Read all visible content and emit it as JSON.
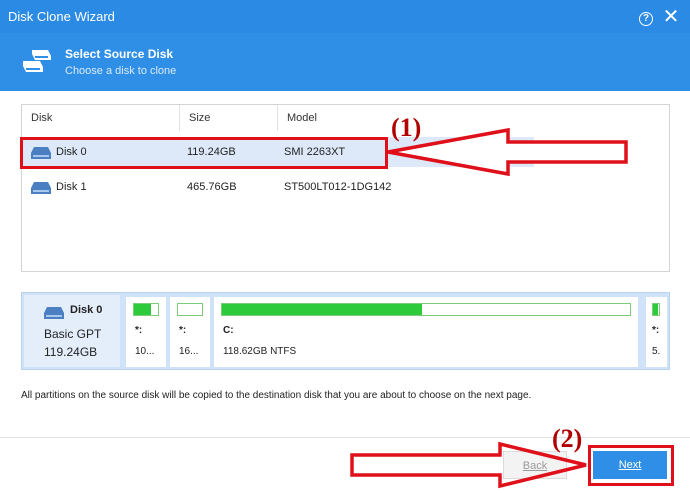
{
  "window": {
    "title": "Disk Clone Wizard",
    "help_glyph": "?",
    "close_glyph": "✕"
  },
  "header": {
    "title": "Select Source Disk",
    "subtitle": "Choose a disk to clone",
    "icon": "disk-stack-icon"
  },
  "table": {
    "columns": [
      "Disk",
      "Size",
      "Model"
    ],
    "rows": [
      {
        "disk": "Disk 0",
        "size": "119.24GB",
        "model": "SMI 2263XT",
        "selected": true
      },
      {
        "disk": "Disk 1",
        "size": "465.76GB",
        "model": "ST500LT012-1DG142",
        "selected": false
      }
    ]
  },
  "disk_map": {
    "name": "Disk 0",
    "type": "Basic GPT",
    "size": "119.24GB",
    "partitions": [
      {
        "name": "*:",
        "info": "10...",
        "usage": 0.7
      },
      {
        "name": "*:",
        "info": "16...",
        "usage": 0.0
      },
      {
        "name": "C:",
        "info": "118.62GB NTFS",
        "usage": 0.49
      },
      {
        "name": "*:",
        "info": "5.",
        "usage": 0.9
      }
    ]
  },
  "note": "All partitions on the source disk will be copied to the destination disk that you are about to choose on the next page.",
  "buttons": {
    "back": "Back",
    "next": "Next"
  },
  "annotations": {
    "step1": "(1)",
    "step2": "(2)"
  },
  "colors": {
    "accent": "#2f8fe6",
    "selected_row": "#dde9f8",
    "annotation_red": "#e0101a",
    "partition_green": "#2dca3b"
  }
}
